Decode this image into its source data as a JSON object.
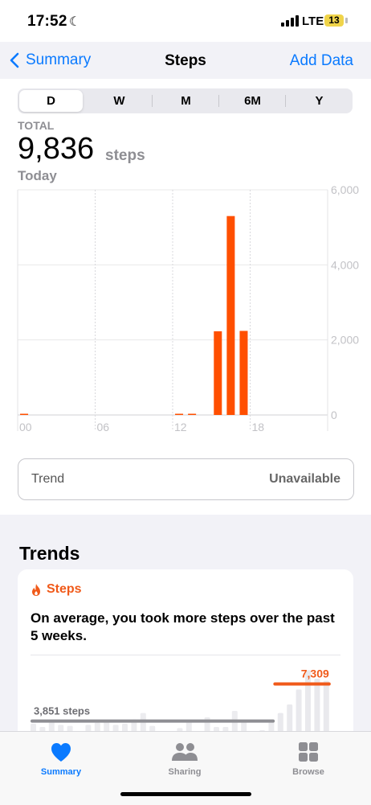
{
  "status": {
    "time": "17:52",
    "network": "LTE",
    "battery": "13"
  },
  "nav": {
    "back_label": "Summary",
    "title": "Steps",
    "action_label": "Add Data"
  },
  "segments": [
    {
      "label": "D",
      "selected": true
    },
    {
      "label": "W",
      "selected": false
    },
    {
      "label": "M",
      "selected": false
    },
    {
      "label": "6M",
      "selected": false
    },
    {
      "label": "Y",
      "selected": false
    }
  ],
  "summary": {
    "label": "TOTAL",
    "value": "9,836",
    "unit": "steps",
    "period": "Today"
  },
  "chart_data": {
    "type": "bar",
    "x_tick_labels": [
      "00",
      "06",
      "12",
      "18"
    ],
    "y_tick_labels": [
      "6,000",
      "4,000",
      "2,000",
      "0"
    ],
    "ylim": [
      0,
      6000
    ],
    "hours": [
      0,
      1,
      2,
      3,
      4,
      5,
      6,
      7,
      8,
      9,
      10,
      11,
      12,
      13,
      14,
      15,
      16,
      17,
      18,
      19,
      20,
      21,
      22,
      23
    ],
    "values": [
      20,
      0,
      0,
      0,
      0,
      0,
      0,
      0,
      0,
      0,
      0,
      0,
      20,
      20,
      0,
      2230,
      5300,
      2240,
      0,
      0,
      0,
      0,
      0,
      0
    ],
    "bar_color": "#ff4f00"
  },
  "trend_row": {
    "label": "Trend",
    "value": "Unavailable"
  },
  "trends": {
    "heading": "Trends",
    "card_title": "Steps",
    "message": "On average, you took more steps over the past 5 weeks.",
    "past_avg_label": "3,851 steps",
    "recent_avg_label": "7,309",
    "accent": "#f05a1a",
    "chart_data": {
      "type": "bar",
      "values": [
        3600,
        3300,
        3800,
        3500,
        3400,
        2600,
        3500,
        3700,
        3900,
        3500,
        3600,
        4000,
        4600,
        3400,
        1600,
        2800,
        3200,
        3800,
        2900,
        4200,
        3300,
        3300,
        4800,
        3800,
        2700,
        3000,
        4000,
        4600,
        5400,
        6800,
        8600,
        7800,
        7600
      ],
      "past_avg": 3851,
      "recent_avg": 7309,
      "recent_start_index": 27
    }
  },
  "tabs": [
    {
      "label": "Summary",
      "icon": "heart-icon",
      "active": true
    },
    {
      "label": "Sharing",
      "icon": "people-icon",
      "active": false
    },
    {
      "label": "Browse",
      "icon": "grid-icon",
      "active": false
    }
  ],
  "colors": {
    "tint": "#0a7aff",
    "inactive": "#8e8e93"
  }
}
